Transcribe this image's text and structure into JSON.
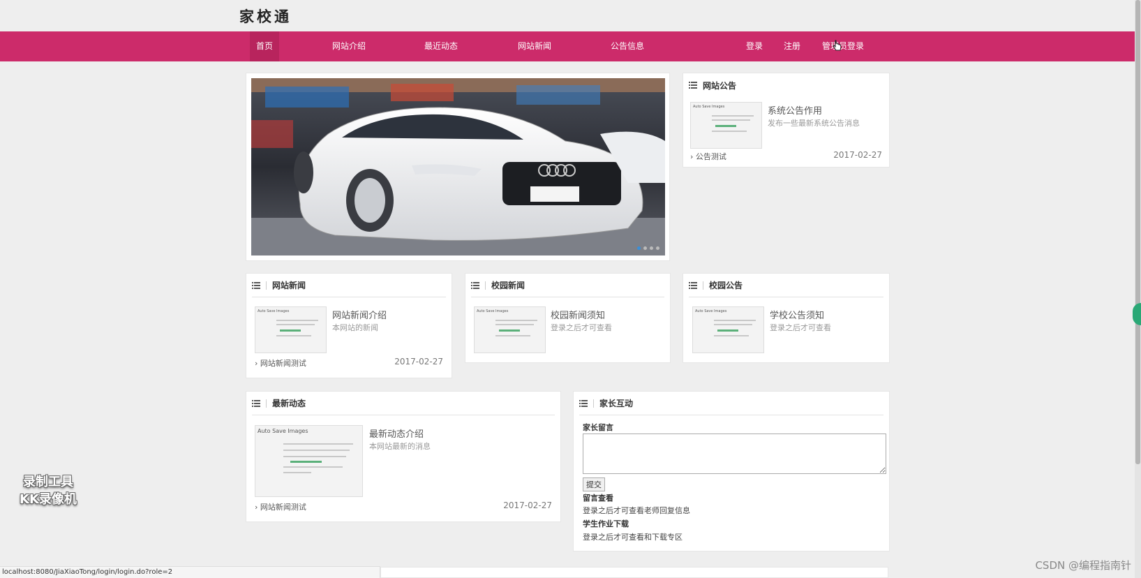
{
  "site": {
    "title": "家校通"
  },
  "nav": {
    "items": [
      "首页",
      "网站介绍",
      "最近动态",
      "网站新闻",
      "公告信息"
    ],
    "login": "登录",
    "register": "注册",
    "admin_login": "管理员登录"
  },
  "colors": {
    "brand": "#cc2b6a",
    "brand_active": "#b8245d",
    "carousel_active_dot": "#3a8fd9"
  },
  "site_notice": {
    "header": "网站公告",
    "thumb_caption": "Auto Save Images",
    "item_title": "系统公告作用",
    "item_sub": "发布一些最新系统公告消息",
    "foot_link": "公告测试",
    "date": "2017-02-27"
  },
  "site_news": {
    "header": "网站新闻",
    "thumb_caption": "Auto Save Images",
    "item_title": "网站新闻介绍",
    "item_sub": "本网站的新闻",
    "foot_link": "网站新闻测试",
    "date": "2017-02-27"
  },
  "campus_news": {
    "header": "校园新闻",
    "thumb_caption": "Auto Save Images",
    "item_title": "校园新闻须知",
    "item_sub": "登录之后才可查看"
  },
  "campus_notice": {
    "header": "校园公告",
    "thumb_caption": "Auto Save Images",
    "item_title": "学校公告须知",
    "item_sub": "登录之后才可查看"
  },
  "latest": {
    "header": "最新动态",
    "thumb_caption": "Auto Save Images",
    "item_title": "最新动态介绍",
    "item_sub": "本网站最新的消息",
    "foot_link": "网站新闻测试",
    "date": "2017-02-27"
  },
  "parent": {
    "header": "家长互动",
    "message_label": "家长留言",
    "message_value": "",
    "submit": "提交",
    "view_label": "留言查看",
    "view_text": "登录之后才可查看老师回复信息",
    "homework_label": "学生作业下载",
    "homework_text": "登录之后才可查看和下载专区"
  },
  "status_url": "localhost:8080/JiaXiaoTong/login/login.do?role=2",
  "watermark": {
    "line1": "录制工具",
    "line2": "KK录像机",
    "csdn": "CSDN @编程指南针"
  }
}
